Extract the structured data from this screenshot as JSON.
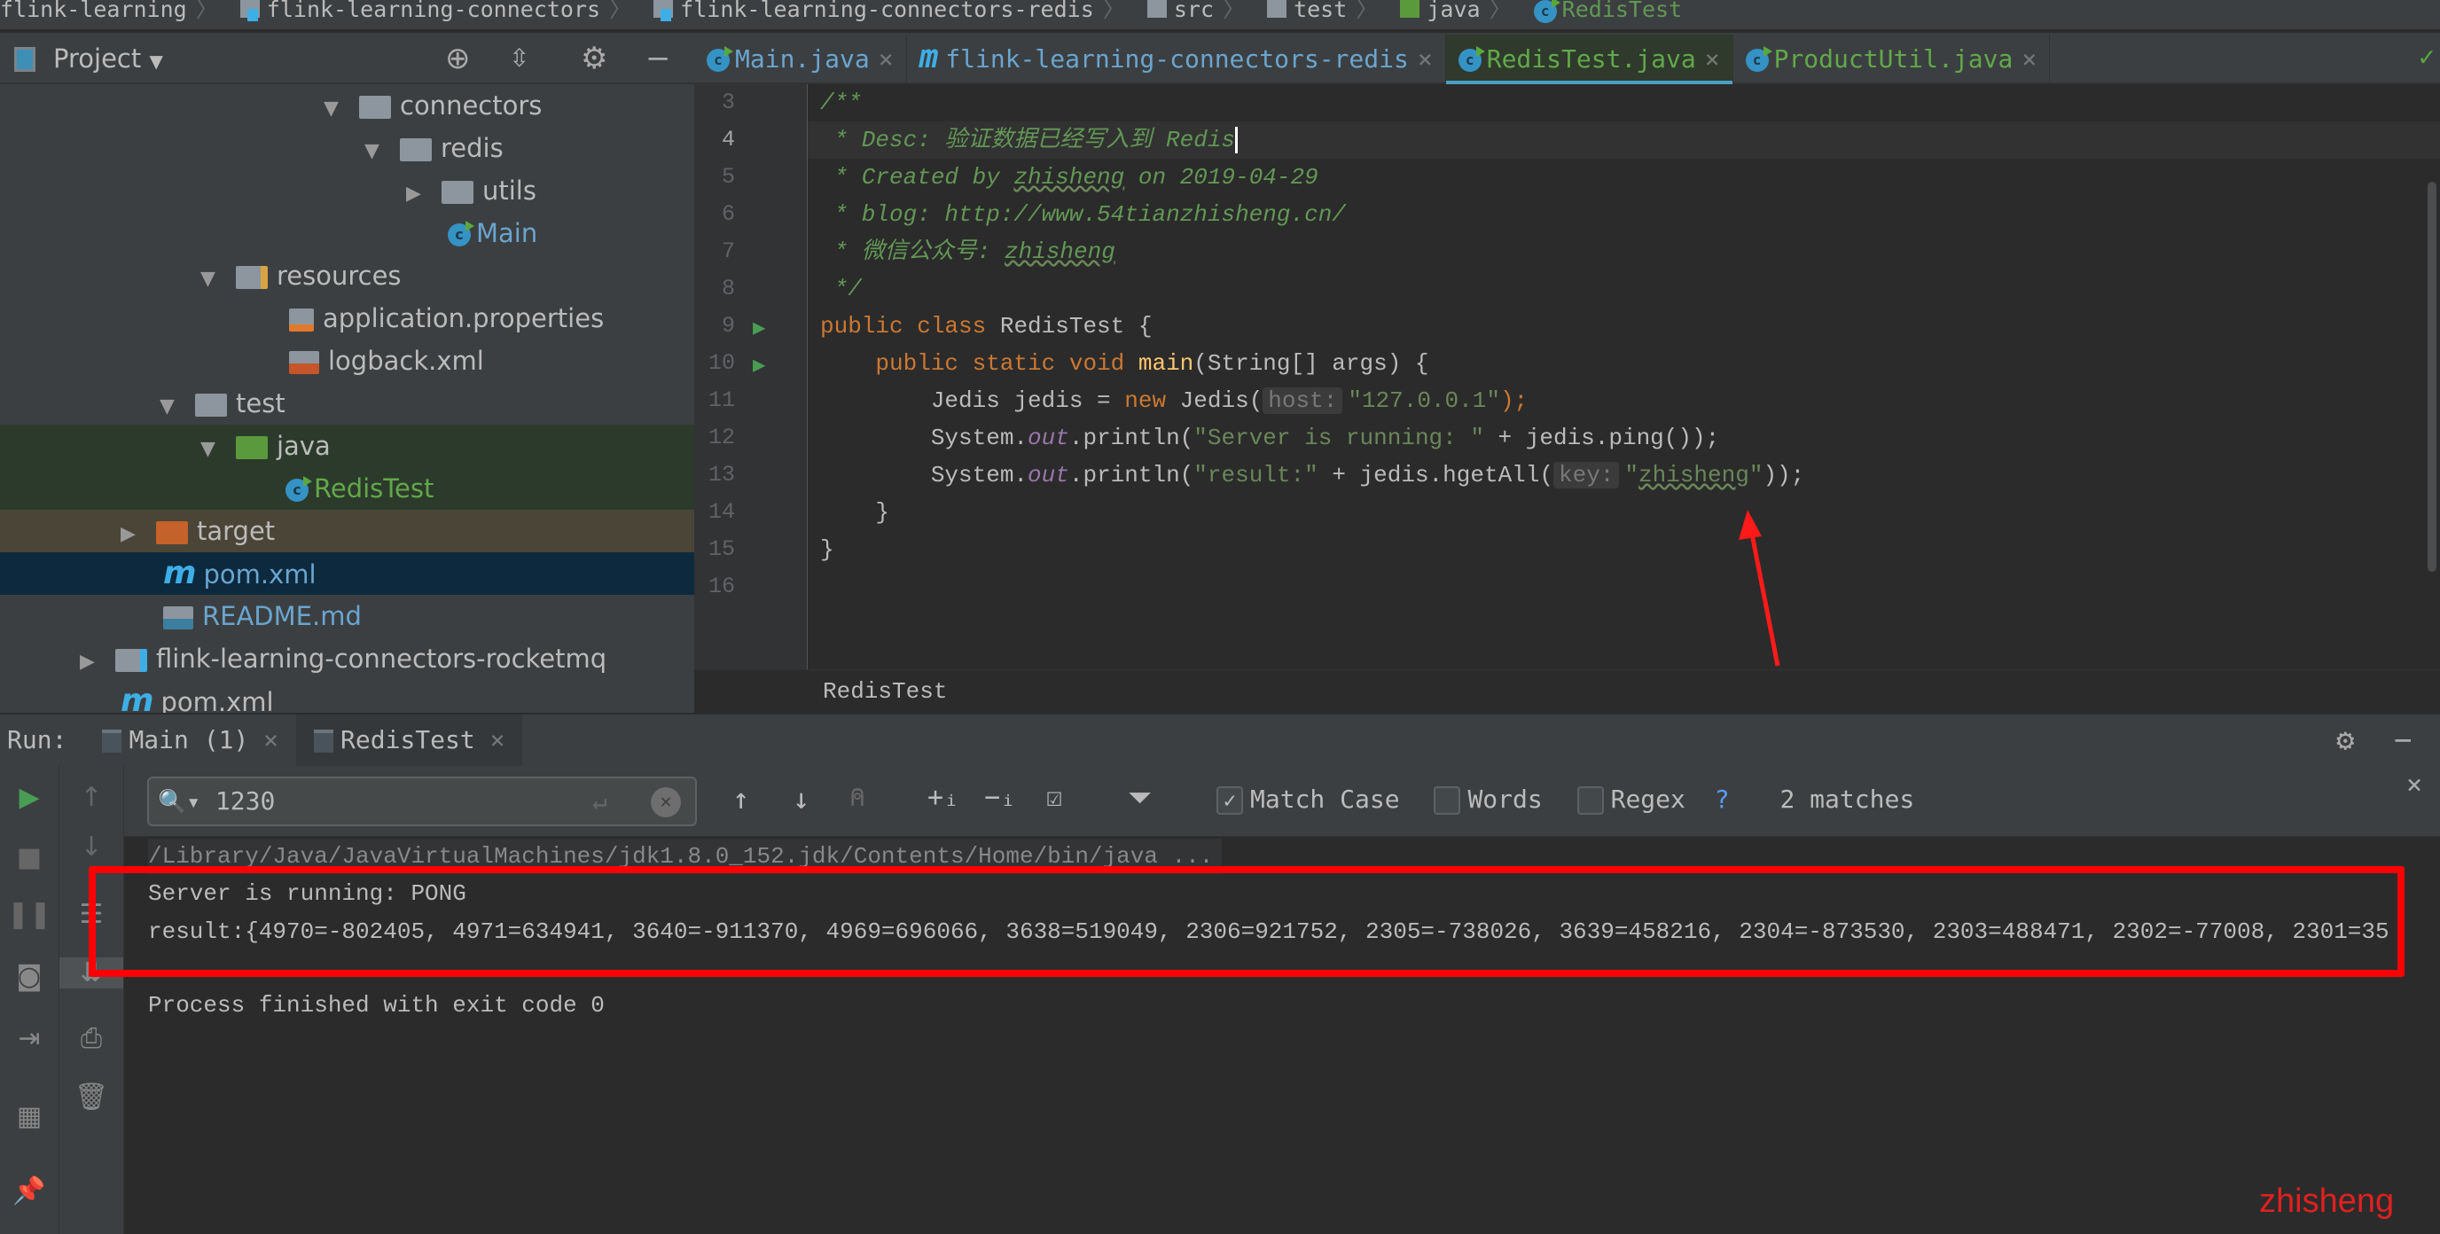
{
  "breadcrumbs": [
    "flink-learning",
    "flink-learning-connectors",
    "flink-learning-connectors-redis",
    "src",
    "test",
    "java",
    "RedisTest"
  ],
  "project_panel": {
    "title": "Project",
    "tree": [
      {
        "label": "connectors"
      },
      {
        "label": "redis"
      },
      {
        "label": "utils"
      },
      {
        "label": "Main"
      },
      {
        "label": "resources"
      },
      {
        "label": "application.properties"
      },
      {
        "label": "logback.xml"
      },
      {
        "label": "test"
      },
      {
        "label": "java"
      },
      {
        "label": "RedisTest"
      },
      {
        "label": "target"
      },
      {
        "label": "pom.xml"
      },
      {
        "label": "README.md"
      },
      {
        "label": "flink-learning-connectors-rocketmq"
      },
      {
        "label": "pom.xml"
      }
    ]
  },
  "editor_tabs": [
    {
      "label": "Main.java"
    },
    {
      "label": "flink-learning-connectors-redis"
    },
    {
      "label": "RedisTest.java",
      "active": true
    },
    {
      "label": "ProductUtil.java"
    }
  ],
  "editor": {
    "line_numbers": [
      "3",
      "4",
      "5",
      "6",
      "7",
      "8",
      "9",
      "10",
      "11",
      "12",
      "13",
      "14",
      "15",
      "16"
    ],
    "code": {
      "l3": "/**",
      "l4": " * Desc: 验证数据已经写入到 Redis",
      "l5a": " * Created by ",
      "l5b": "zhisheng",
      "l5c": " on 2019-04-29",
      "l6": " * blog: http://www.54tianzhisheng.cn/",
      "l7a": " * 微信公众号: ",
      "l7b": "zhisheng",
      "l8": " */",
      "l9a": "public class ",
      "l9b": "RedisTest {",
      "l10a": "    public static void ",
      "l10b": "main",
      "l10c": "(String[] args) {",
      "l11a": "        Jedis jedis = ",
      "l11b": "new",
      "l11c": " Jedis(",
      "l11hint": "host:",
      "l11d": "\"127.0.0.1\"",
      "l11e": ");",
      "l12a": "        System.",
      "l12b": "out",
      "l12c": ".println(",
      "l12d": "\"Server is running: \"",
      "l12e": " + jedis.ping());",
      "l13a": "        System.",
      "l13b": "out",
      "l13c": ".println(",
      "l13d": "\"result:\"",
      "l13e": " + jedis.hgetAll(",
      "l13hint": "key:",
      "l13f": "\"",
      "l13g": "zhisheng",
      "l13h": "\"",
      "l13i": "));",
      "l14": "    }",
      "l15": "}"
    },
    "breadcrumb": "RedisTest"
  },
  "run_panel": {
    "label": "Run:",
    "tabs": [
      {
        "label": "Main (1)"
      },
      {
        "label": "RedisTest"
      }
    ],
    "find": {
      "query": "1230",
      "match_case": {
        "label": "Match Case",
        "checked": true
      },
      "words": {
        "label": "Words",
        "checked": false
      },
      "regex": {
        "label": "Regex",
        "checked": false
      },
      "help": "?",
      "matches": "2 matches"
    },
    "console": [
      "/Library/Java/JavaVirtualMachines/jdk1.8.0_152.jdk/Contents/Home/bin/java ...",
      "Server is running: PONG",
      "result:{4970=-802405, 4971=634941, 3640=-911370, 4969=696066, 3638=519049, 2306=921752, 2305=-738026, 3639=458216, 2304=-873530, 2303=488471, 2302=-77008, 2301=35",
      "Process finished with exit code 0"
    ]
  },
  "watermark": "zhisheng",
  "colors": {
    "annotation": "#ff0000",
    "accent": "#4a9fc3"
  }
}
